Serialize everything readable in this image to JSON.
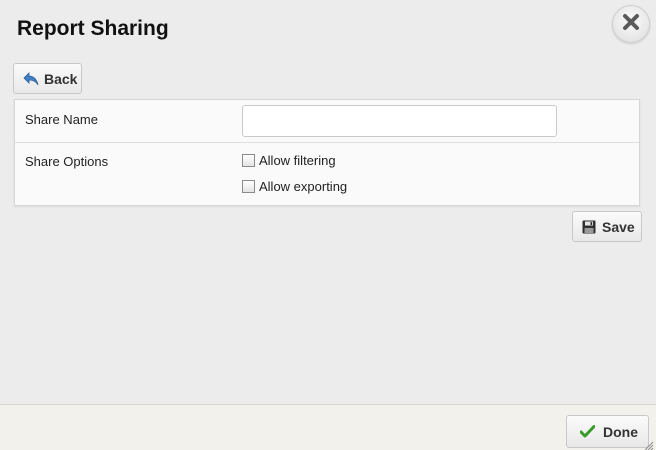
{
  "dialog": {
    "title": "Report Sharing",
    "close_icon": "close-x-icon"
  },
  "toolbar": {
    "back_label": "Back",
    "back_icon": "back-arrow-icon"
  },
  "form": {
    "share_name_label": "Share Name",
    "share_name_value": "",
    "share_name_placeholder": "",
    "share_options_label": "Share Options",
    "options": [
      {
        "label": "Allow filtering",
        "checked": false
      },
      {
        "label": "Allow exporting",
        "checked": false
      }
    ]
  },
  "actions": {
    "save_label": "Save",
    "save_icon": "floppy-disk-icon"
  },
  "footer": {
    "done_label": "Done",
    "done_icon": "checkmark-icon"
  },
  "colors": {
    "background": "#ececec",
    "panel": "#fafafa",
    "done_check": "#3a9a2a",
    "back_arrow": "#3f7fc2"
  }
}
